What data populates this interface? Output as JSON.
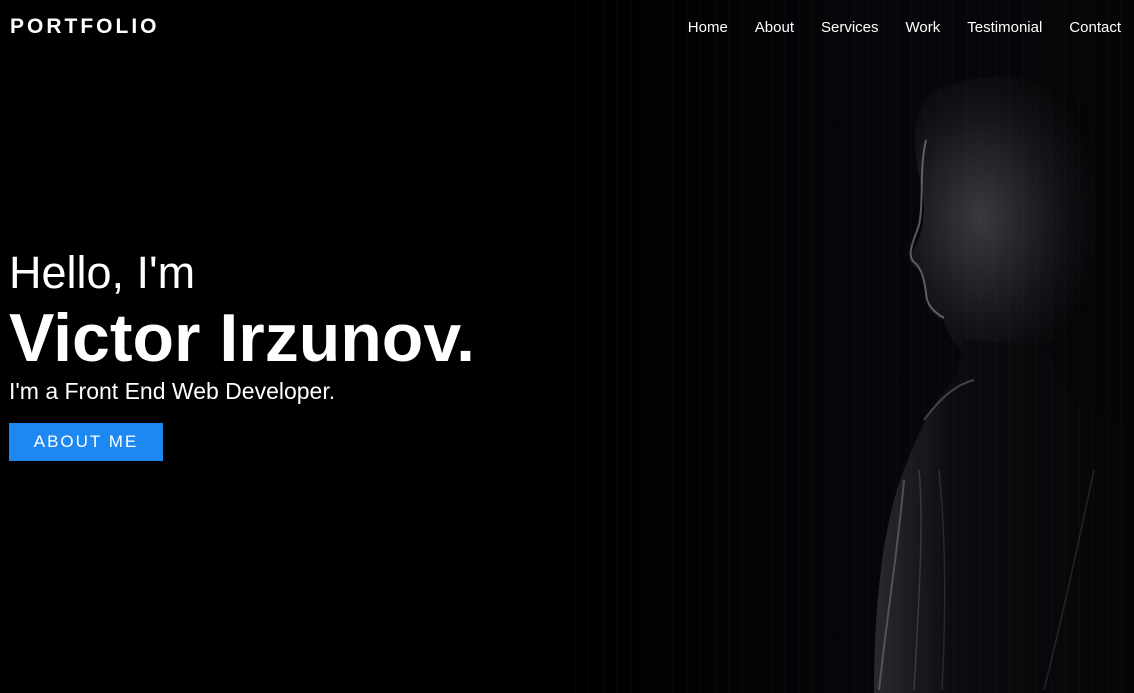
{
  "navbar": {
    "brand": "PORTFOLIO",
    "links": [
      "Home",
      "About",
      "Services",
      "Work",
      "Testimonial",
      "Contact"
    ]
  },
  "hero": {
    "greeting": "Hello, I'm",
    "name": "Victor Irzunov.",
    "tagline": "I'm a Front End Web Developer.",
    "cta_label": "ABOUT ME"
  },
  "colors": {
    "background": "#000000",
    "text": "#ffffff",
    "accent": "#1e88f2"
  },
  "icons": {
    "hero_photo": "person-silhouette-photo"
  }
}
